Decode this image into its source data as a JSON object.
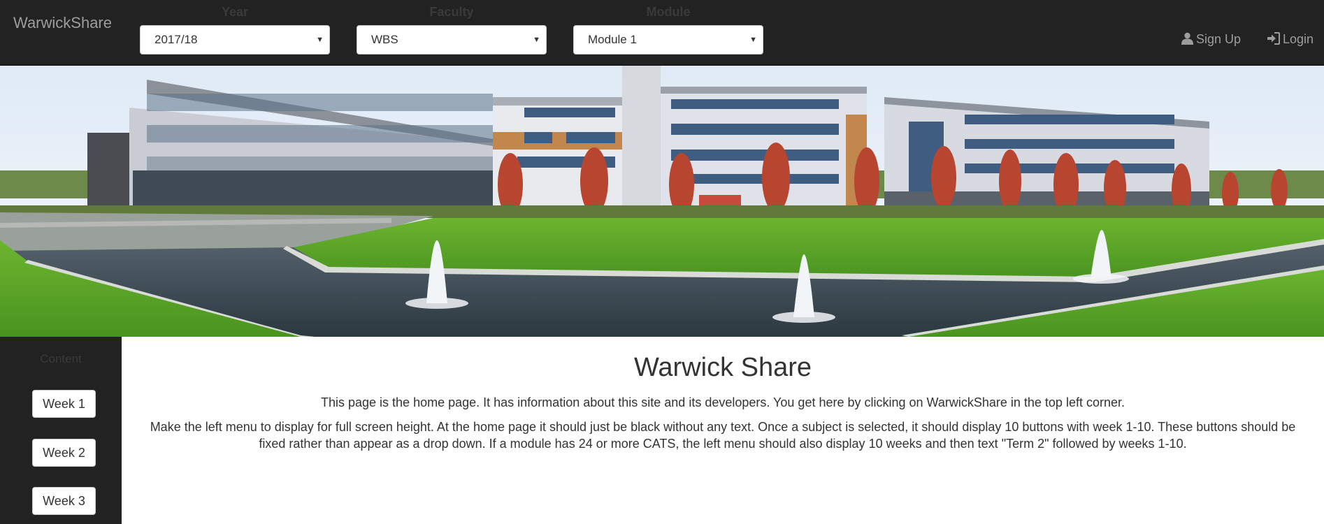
{
  "navbar": {
    "brand": "WarwickShare",
    "selects": [
      {
        "label": "Year",
        "value": "2017/18"
      },
      {
        "label": "Faculty",
        "value": "WBS"
      },
      {
        "label": "Module",
        "value": "Module 1"
      }
    ],
    "signup_label": "Sign Up",
    "login_label": "Login"
  },
  "sidebar": {
    "title": "Content",
    "weeks": [
      "Week 1",
      "Week 2",
      "Week 3"
    ]
  },
  "main": {
    "title": "Warwick Share",
    "paragraph1": "This page is the home page. It has information about this site and its developers. You get here by clicking on WarwickShare in the top left corner.",
    "paragraph2": "Make the left menu to display for full screen height. At the home page it should just be black without any text. Once a subject is selected, it should display 10 buttons with week 1-10. These buttons should be fixed rather than appear as a drop down. If a module has 24 or more CATS, the left menu should also display 10 weeks and then text \"Term 2\" followed by weeks 1-10."
  },
  "colors": {
    "navbar_bg": "#222222",
    "nav_text": "#9d9d9d",
    "grass": "#5fa82a",
    "water": "#3b4a55",
    "sky": "#eef4fb"
  },
  "icons": {
    "signup": "user-icon",
    "login": "login-icon",
    "select_caret": "caret-down-icon"
  }
}
